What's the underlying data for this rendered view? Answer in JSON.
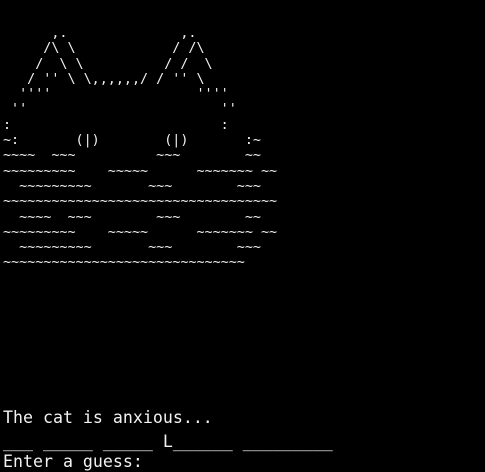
{
  "terminal": {
    "background": "#000000",
    "foreground": "#f2f2f2",
    "art_lines": [
      "      ,.              ,.",
      "     /\\ \\            / /\\",
      "    /  \\ \\          / /  \\",
      "   / '' \\ \\,,,,,,/ / '' \\",
      "  ''''                  ''''",
      " ''                        ''",
      ":                          :",
      "~:       (|)        (|)       :~",
      "~~~~  ~~~          ~~~        ~~",
      "~~~~~~~~~    ~~~~~      ~~~~~~~ ~~",
      "  ~~~~~~~~~       ~~~        ~~~",
      "~~~~~~~~~~~~~~~~~~~~~~~~~~~~~~~~~~",
      "  ~~~~  ~~~        ~~~        ~~",
      "~~~~~~~~~    ~~~~~      ~~~~~~~ ~~",
      "  ~~~~~~~~~       ~~~        ~~~",
      "~~~~~~~~~~~~~~~~~~~~~~~~~~~~~~"
    ],
    "status_text": "The cat is anxious...",
    "word_display": "___ _____ _____ L______ _________",
    "prompt_text": "Enter a guess:"
  }
}
